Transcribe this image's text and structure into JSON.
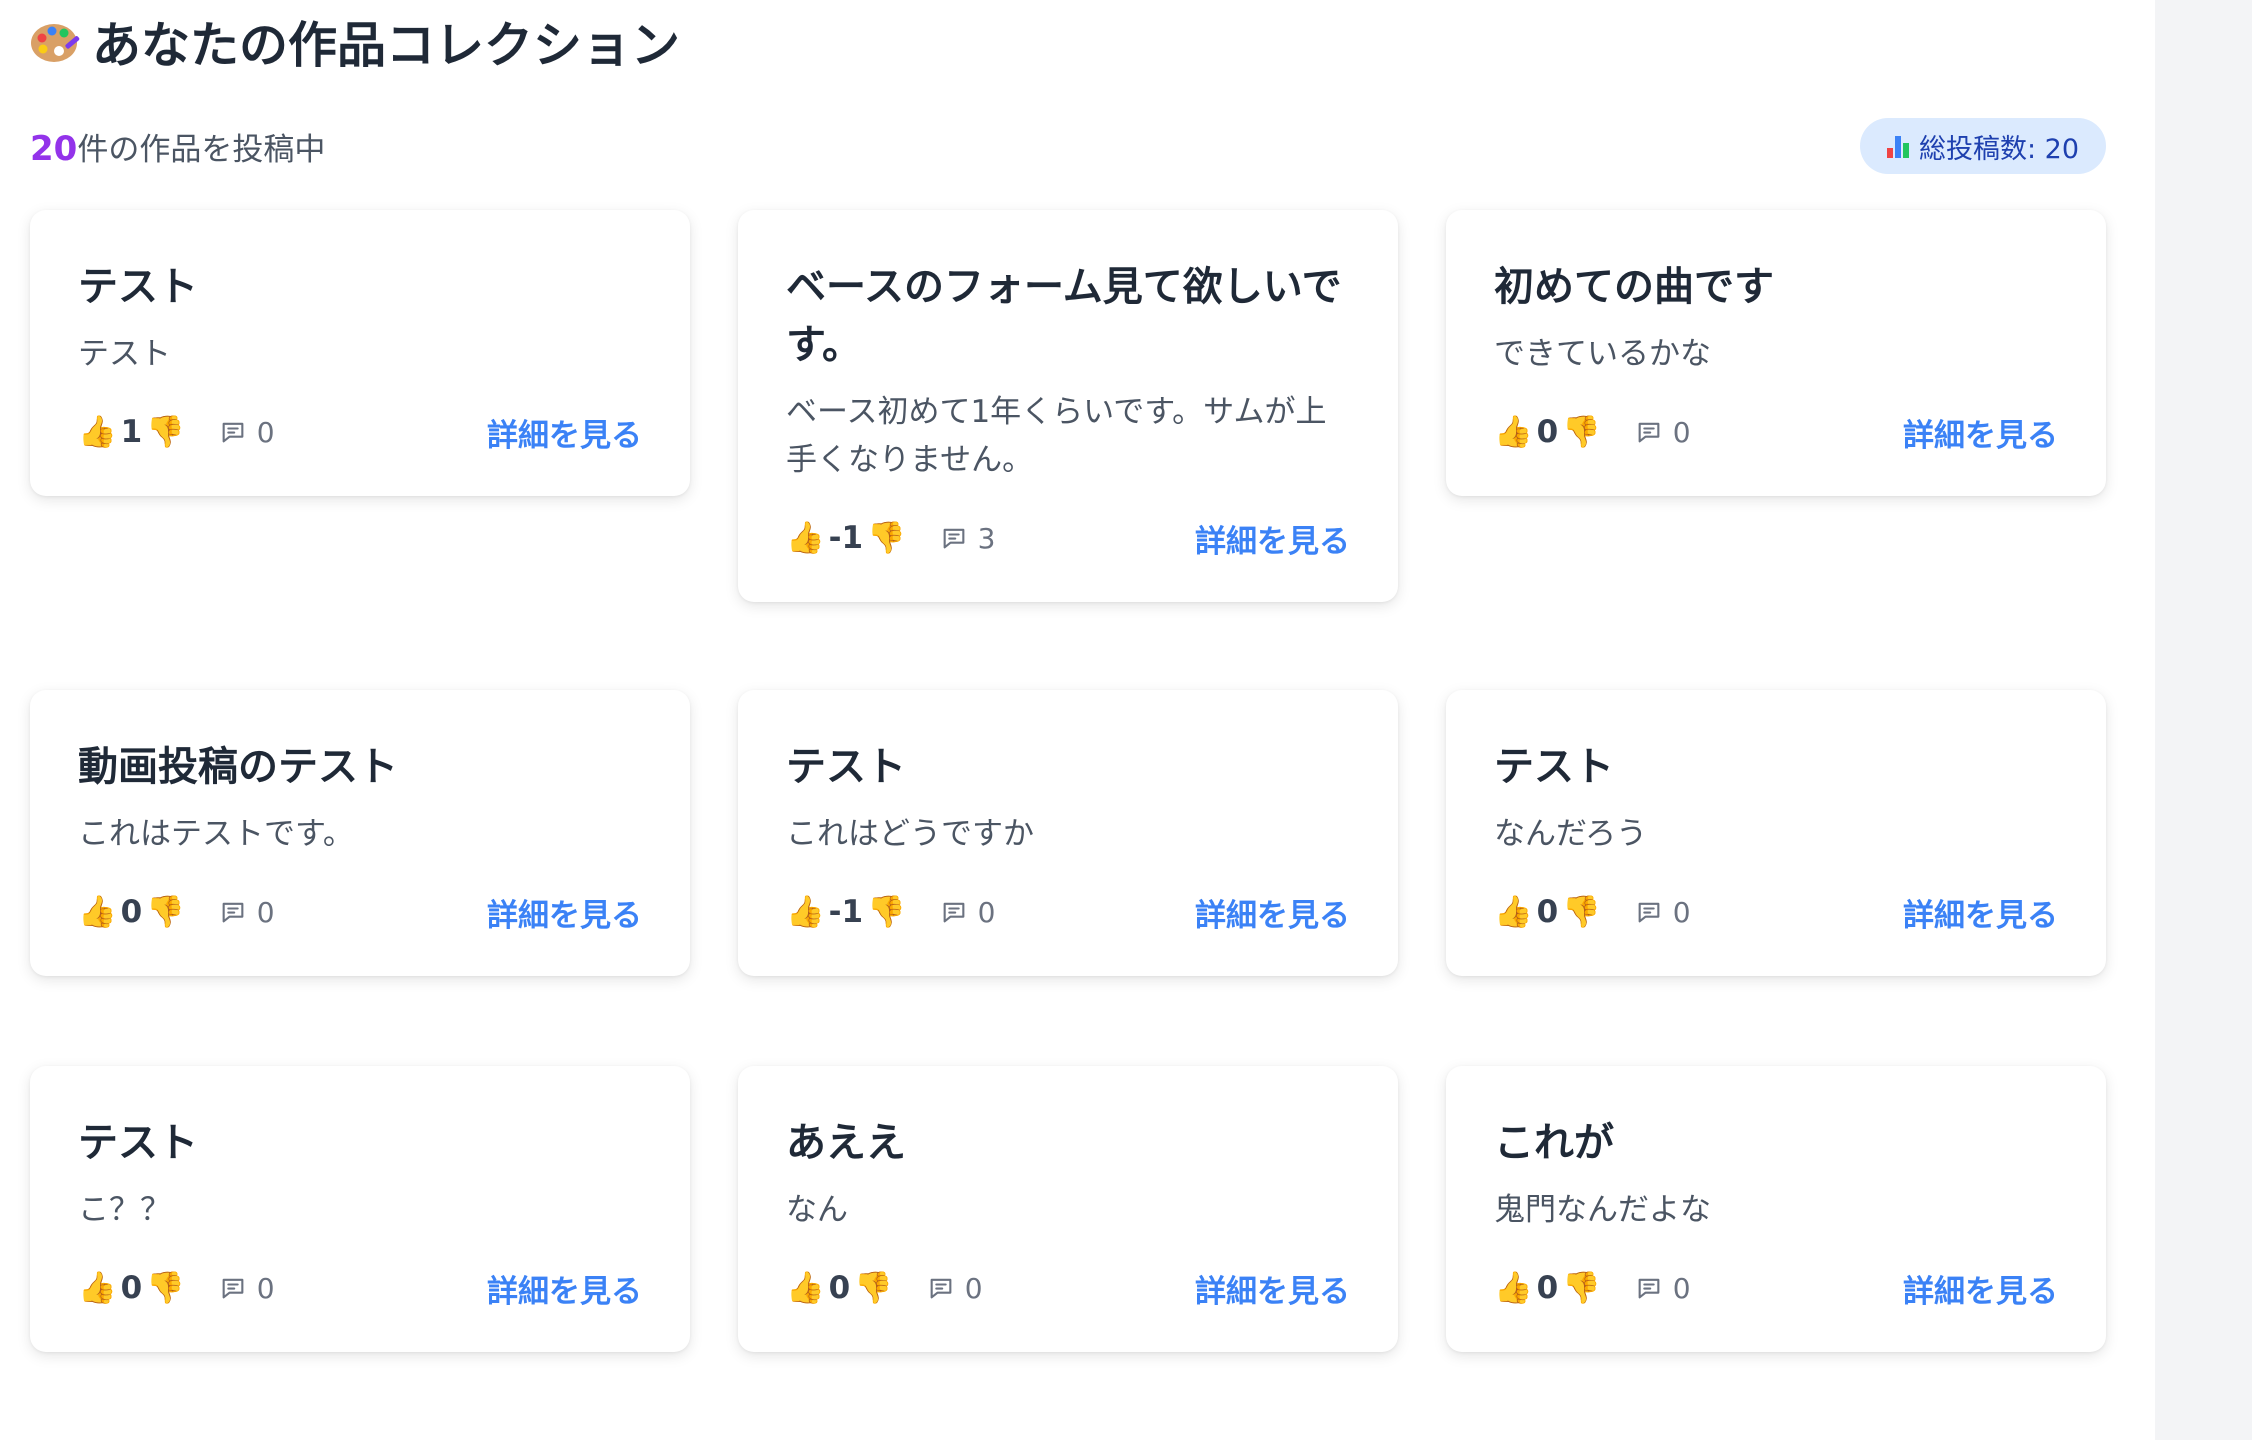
{
  "header": {
    "title": "あなたの作品コレクション",
    "title_icon": "palette-icon"
  },
  "summary": {
    "count": "20",
    "suffix": "件の作品を投稿中"
  },
  "total_badge": {
    "icon": "bar-chart-icon",
    "label": "総投稿数: 20"
  },
  "cards": [
    {
      "title": "テスト",
      "description": "テスト",
      "votes": "1",
      "comments": "0",
      "link": "詳細を見る"
    },
    {
      "title": "ベースのフォーム見て欲しいです。",
      "description": "ベース初めて1年くらいです。サムが上手くなりません。",
      "votes": "-1",
      "comments": "3",
      "link": "詳細を見る"
    },
    {
      "title": "初めての曲です",
      "description": "できているかな",
      "votes": "0",
      "comments": "0",
      "link": "詳細を見る"
    },
    {
      "title": "動画投稿のテスト",
      "description": "これはテストです。",
      "votes": "0",
      "comments": "0",
      "link": "詳細を見る"
    },
    {
      "title": "テスト",
      "description": "これはどうですか",
      "votes": "-1",
      "comments": "0",
      "link": "詳細を見る"
    },
    {
      "title": "テスト",
      "description": "なんだろう",
      "votes": "0",
      "comments": "0",
      "link": "詳細を見る"
    },
    {
      "title": "テスト",
      "description": "こ？？",
      "votes": "0",
      "comments": "0",
      "link": "詳細を見る"
    },
    {
      "title": "あええ",
      "description": "なん",
      "votes": "0",
      "comments": "0",
      "link": "詳細を見る"
    },
    {
      "title": "これが",
      "description": "鬼門なんだよな",
      "votes": "0",
      "comments": "0",
      "link": "詳細を見る"
    }
  ],
  "icons": {
    "upvote": "thumbs-up-icon",
    "downvote": "thumbs-down-icon",
    "comments": "comment-icon"
  },
  "colors": {
    "accent_count": "#9333ea",
    "link": "#3b82f6",
    "badge_bg": "#dbeafe",
    "badge_text": "#1e40af"
  }
}
